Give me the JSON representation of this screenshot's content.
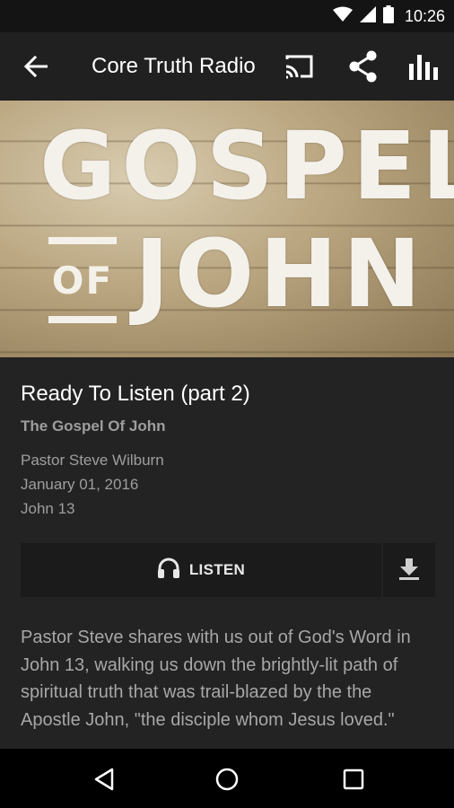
{
  "status_bar": {
    "time": "10:26",
    "icons": [
      "wifi-icon",
      "cell-signal-icon",
      "battery-icon"
    ]
  },
  "app_bar": {
    "title": "Core Truth Radio",
    "icons": [
      "back-arrow-icon",
      "cast-icon",
      "share-icon",
      "equalizer-icon"
    ]
  },
  "hero": {
    "line1": "GOSPEL",
    "of": "OF",
    "line2": "JOHN"
  },
  "sermon": {
    "title": "Ready To Listen (part 2)",
    "series": "The Gospel Of John",
    "speaker": "Pastor Steve Wilburn",
    "date": "January 01, 2016",
    "passage": "John 13"
  },
  "actions": {
    "listen_label": "LISTEN"
  },
  "description": "Pastor Steve shares with us out of God's Word in John 13, walking us down the brightly-lit path of spiritual truth that was trail-blazed by the the Apostle John, \"the disciple whom Jesus loved.\"",
  "nav_bar": {
    "icons": [
      "nav-back-icon",
      "nav-home-icon",
      "nav-recents-icon"
    ]
  },
  "colors": {
    "background": "#232323",
    "app_bar": "#202020",
    "status_bar": "#141414",
    "button": "#1b1b1b",
    "secondary_text": "#9e9e9e"
  }
}
